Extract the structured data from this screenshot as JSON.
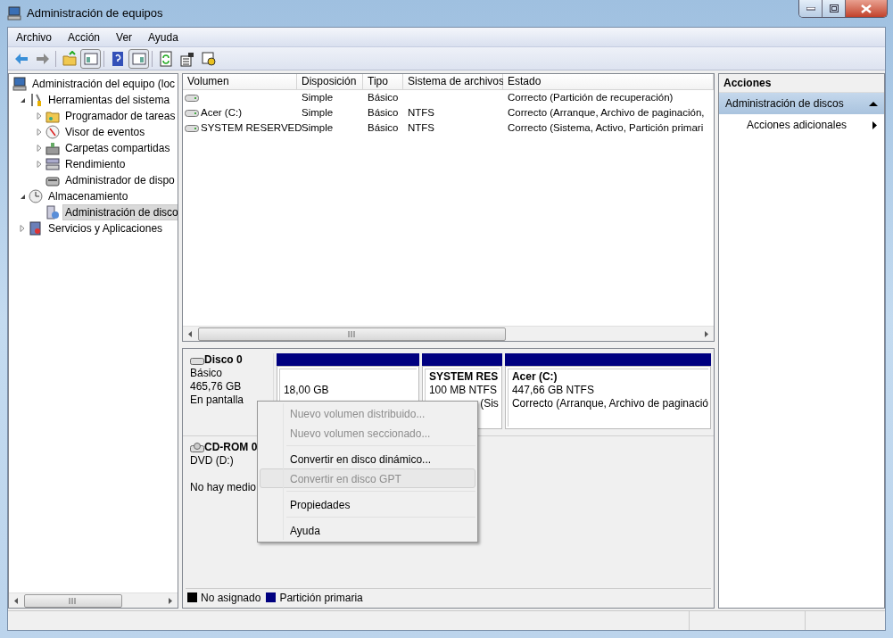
{
  "window": {
    "title": "Administración de equipos"
  },
  "menu": [
    "Archivo",
    "Acción",
    "Ver",
    "Ayuda"
  ],
  "tree": [
    {
      "label": "Administración del equipo (loc",
      "selected": false,
      "children": [
        {
          "label": "Herramientas del sistema",
          "selected": false,
          "expanded": true,
          "children": [
            {
              "label": "Programador de tareas",
              "selected": false,
              "expanded": false
            },
            {
              "label": "Visor de eventos",
              "selected": false,
              "expanded": false
            },
            {
              "label": "Carpetas compartidas",
              "selected": false,
              "expanded": false
            },
            {
              "label": "Rendimiento",
              "selected": false,
              "expanded": false
            },
            {
              "label": "Administrador de dispo",
              "selected": false
            }
          ]
        },
        {
          "label": "Almacenamiento",
          "selected": false,
          "expanded": true,
          "children": [
            {
              "label": "Administración de disco",
              "selected": true
            }
          ]
        },
        {
          "label": "Servicios y Aplicaciones",
          "selected": false,
          "expanded": false
        }
      ]
    }
  ],
  "volumes": {
    "columns": [
      "Volumen",
      "Disposición",
      "Tipo",
      "Sistema de archivos",
      "Estado"
    ],
    "rows": [
      [
        "",
        "Simple",
        "Básico",
        "",
        "Correcto (Partición de recuperación)"
      ],
      [
        "Acer (C:)",
        "Simple",
        "Básico",
        "NTFS",
        "Correcto (Arranque, Archivo de paginación,"
      ],
      [
        "SYSTEM RESERVED",
        "Simple",
        "Básico",
        "NTFS",
        "Correcto (Sistema, Activo, Partición primari"
      ]
    ]
  },
  "disks": [
    {
      "name": "Disco 0",
      "lines": [
        "Básico",
        "465,76 GB",
        "En pantalla"
      ],
      "partitions": [
        {
          "lines": [
            "18,00 GB"
          ],
          "color": "#000080"
        },
        {
          "title": "SYSTEM RES",
          "lines": [
            "100 MB NTFS",
            "(Sis"
          ],
          "color": "#000080"
        },
        {
          "title": "Acer  (C:)",
          "lines": [
            "447,66 GB NTFS",
            "Correcto (Arranque, Archivo de paginació"
          ],
          "color": "#000080"
        }
      ]
    },
    {
      "name": "CD-ROM 0",
      "lines": [
        "DVD (D:)"
      ],
      "note": "No hay medio"
    }
  ],
  "legend": [
    {
      "label": "No asignado",
      "color": "#000000"
    },
    {
      "label": "Partición primaria",
      "color": "#000080"
    }
  ],
  "actions": {
    "title": "Acciones",
    "section": "Administración de discos",
    "items": [
      "Acciones adicionales"
    ]
  },
  "context_menu": [
    {
      "kind": "item",
      "label": "Nuevo volumen distribuido...",
      "disabled": true,
      "selected": false
    },
    {
      "kind": "item",
      "label": "Nuevo volumen seccionado...",
      "disabled": true,
      "selected": false
    },
    {
      "kind": "separator"
    },
    {
      "kind": "item",
      "label": "Convertir en disco dinámico...",
      "disabled": false,
      "selected": false
    },
    {
      "kind": "item",
      "label": "Convertir en disco GPT",
      "disabled": true,
      "selected": true
    },
    {
      "kind": "separator"
    },
    {
      "kind": "item",
      "label": "Propiedades",
      "disabled": false,
      "selected": false
    },
    {
      "kind": "separator"
    },
    {
      "kind": "item",
      "label": "Ayuda",
      "disabled": false,
      "selected": false
    }
  ]
}
